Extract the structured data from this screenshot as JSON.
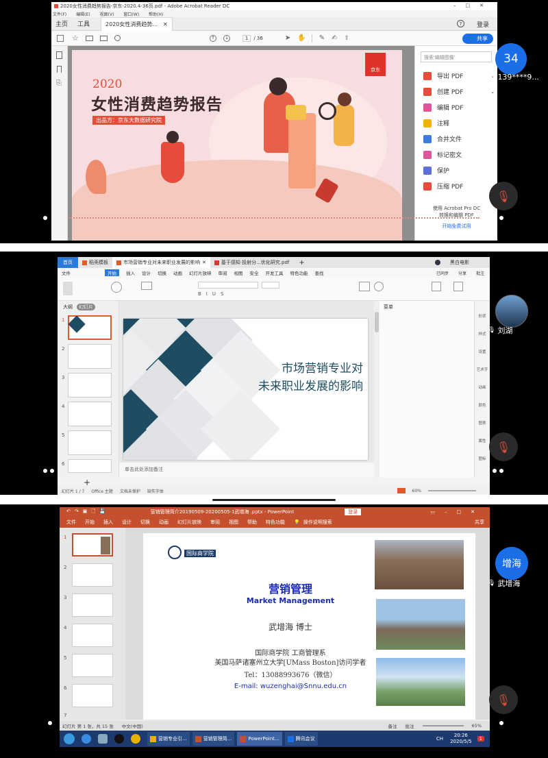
{
  "colors": {
    "pdf_red": "#e54d3b",
    "ppt_orange": "#c5502d",
    "teal": "#1e4d63",
    "zoom_blue": "#1a6fe8"
  },
  "pdf": {
    "title": "2020女性消费趋势报告-京东-2020.4-36页.pdf - Adobe Acrobat Reader DC",
    "menu": [
      "文件(F)",
      "编辑(E)",
      "视图(V)",
      "窗口(W)",
      "帮助(H)"
    ],
    "tabs": {
      "home": "主页",
      "tools": "工具",
      "doc": "2020女性消费趋势..."
    },
    "login": "登录",
    "page_current": "1",
    "page_total": "/ 36",
    "share": "共享",
    "search_placeholder": "搜索'编辑图像'",
    "side_items": [
      {
        "label": "导出 PDF",
        "color": "#e54d3b"
      },
      {
        "label": "创建 PDF",
        "color": "#e54d3b"
      },
      {
        "label": "编辑 PDF",
        "color": "#e0559a"
      },
      {
        "label": "注释",
        "color": "#f0b400"
      },
      {
        "label": "合并文件",
        "color": "#3c7be0"
      },
      {
        "label": "标记密文",
        "color": "#e0559a"
      },
      {
        "label": "保护",
        "color": "#5b6fd6"
      },
      {
        "label": "压缩 PDF",
        "color": "#e54d3b"
      }
    ],
    "promo_line1": "使用 Acrobat Pro DC",
    "promo_line2": "转换和编辑 PDF",
    "trial": "开始免费试用",
    "cover": {
      "year": "2020",
      "title": "女性消费趋势报告",
      "publisher": "出品方：京东大数据研究院",
      "logo": "京东"
    }
  },
  "wps": {
    "tabs": [
      "首页",
      "稻壳模板",
      "市场营销专业对未来职业发展的影响",
      "基于感知·投射分...优化研究.pdf"
    ],
    "menu": [
      "文件",
      "开始",
      "插入",
      "设计",
      "切换",
      "动画",
      "幻灯片放映",
      "审阅",
      "视图",
      "安全",
      "开发工具",
      "特色功能",
      "查找"
    ],
    "user": "黑白电影",
    "right_actions": [
      "已同步",
      "分享",
      "批注"
    ],
    "panel_tabs": [
      "大纲",
      "幻灯片"
    ],
    "slide_text1": "市场营销专业对",
    "slide_text2": "未来职业发展的影响",
    "notes_placeholder": "单击此处添加备注",
    "status": {
      "slide": "幻灯片 1 / 7",
      "theme": "Office 主题",
      "protect": "文档未保护",
      "font": "缺失字体",
      "zoom": "60%"
    },
    "right_panel": [
      "形状",
      "样式",
      "设置",
      "艺术字",
      "动画",
      "颜色",
      "图表",
      "属性",
      "图标"
    ],
    "side_label": "菜单"
  },
  "ppt": {
    "title": "营销管理简介20190509-20200505-1武增海 .pptx - PowerPoint",
    "login": "登录",
    "menu": [
      "文件",
      "开始",
      "插入",
      "设计",
      "切换",
      "动画",
      "幻灯片放映",
      "审阅",
      "视图",
      "帮助",
      "特色功能"
    ],
    "search_hint": "操作说明搜索",
    "share": "共享",
    "school": "国际商学院",
    "slide_title_cn": "营销管理",
    "slide_title_en": "Market Management",
    "author": "武增海  博士",
    "dept": "国际商学院 工商管理系",
    "visiting": "美国马萨诸塞州立大学[UMass Boston]访问学者",
    "tel": "Tel：13088993676（微信）",
    "email": "E-mail: wuzenghai@Snnu.edu.cn",
    "status": {
      "slide": "幻灯片 第 1 张，共 15 张",
      "lang": "中文(中国)",
      "notes": "备注",
      "comments": "批注",
      "zoom": "65%"
    },
    "thumb_numbers": [
      "1",
      "2",
      "3",
      "4",
      "5",
      "6",
      "7"
    ]
  },
  "taskbar": {
    "apps": [
      "营销专业引...",
      "营销管理简...",
      "PowerPoint...",
      "腾讯会议"
    ],
    "time": "20:26",
    "date": "2020/5/5",
    "lang": "CH",
    "notif": "1"
  },
  "participants": [
    {
      "avatar_text": "34",
      "name": "139****9..."
    },
    {
      "avatar_text": "",
      "name": "刘湖"
    },
    {
      "avatar_text": "增海",
      "name": "武增海"
    }
  ]
}
